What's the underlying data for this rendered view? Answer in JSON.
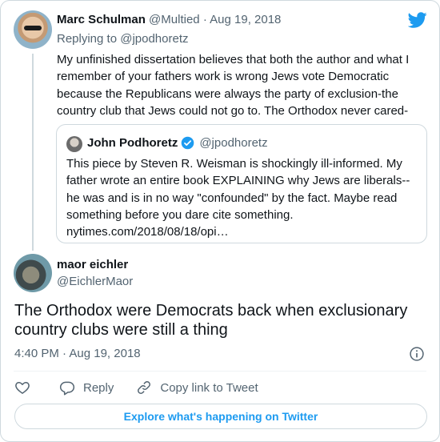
{
  "parent_tweet": {
    "author_name": "Marc Schulman",
    "author_handle": "@Multied",
    "separator": "·",
    "date": "Aug 19, 2018",
    "replying_prefix": "Replying to",
    "replying_handle": "@jpodhoretz",
    "text": "My unfinished dissertation believes that both the author and what I remember of your fathers work is wrong Jews vote Democratic because the Republicans were always the party of exclusion-the country club that Jews could not go to. The Orthodox never cared-"
  },
  "quoted_tweet": {
    "author_name": "John Podhoretz",
    "author_handle": "@jpodhoretz",
    "text": "This piece by Steven R. Weisman is shockingly ill-informed. My father wrote an entire book EXPLAINING why Jews are liberals--he was and is in no way \"confounded\" by the fact. Maybe read something before you dare cite something.",
    "link": "nytimes.com/2018/08/18/opi…"
  },
  "main_tweet": {
    "author_name": "maor eichler",
    "author_handle": "@EichlerMaor",
    "text": "The Orthodox were Democrats back when exclusionary country clubs were still a thing",
    "time": "4:40 PM",
    "separator": "·",
    "date": "Aug 19, 2018"
  },
  "actions": {
    "reply_label": "Reply",
    "copy_link_label": "Copy link to Tweet"
  },
  "footer": {
    "explore_label": "Explore what's happening on Twitter"
  },
  "icons": {
    "brand": "twitter-bird-icon",
    "verified": "verified-badge-icon",
    "info": "info-icon",
    "like": "heart-icon",
    "reply": "reply-bubble-icon",
    "copy_link": "link-icon"
  },
  "colors": {
    "brand_blue": "#1d9bf0",
    "text_primary": "#0f1419",
    "text_secondary": "#536471",
    "border": "#cfd9de"
  }
}
